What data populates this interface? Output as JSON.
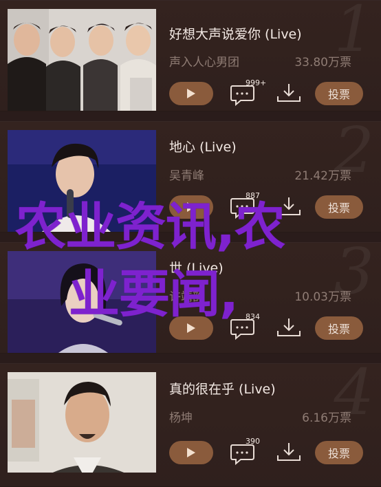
{
  "songs": [
    {
      "rank": "1",
      "title": "好想大声说爱你 (Live)",
      "artist": "声入人心男团",
      "plays": "33.80万票",
      "comments": "999+",
      "vote": "投票"
    },
    {
      "rank": "2",
      "title": "地心 (Live)",
      "artist": "吴青峰",
      "plays": "21.42万票",
      "comments": "887",
      "vote": "投票"
    },
    {
      "rank": "3",
      "title": "世 (Live)",
      "artist": "许靖韵",
      "plays": "10.03万票",
      "comments": "834",
      "vote": "投票"
    },
    {
      "rank": "4",
      "title": "真的很在乎 (Live)",
      "artist": "杨坤",
      "plays": "6.16万票",
      "comments": "390",
      "vote": "投票"
    }
  ],
  "watermark": {
    "line1": "农业资讯,农",
    "line2": "业要闻,"
  },
  "colors": {
    "background": "#2a1c1b",
    "button": "#8a5b3c",
    "watermark": "#7e22ce"
  }
}
